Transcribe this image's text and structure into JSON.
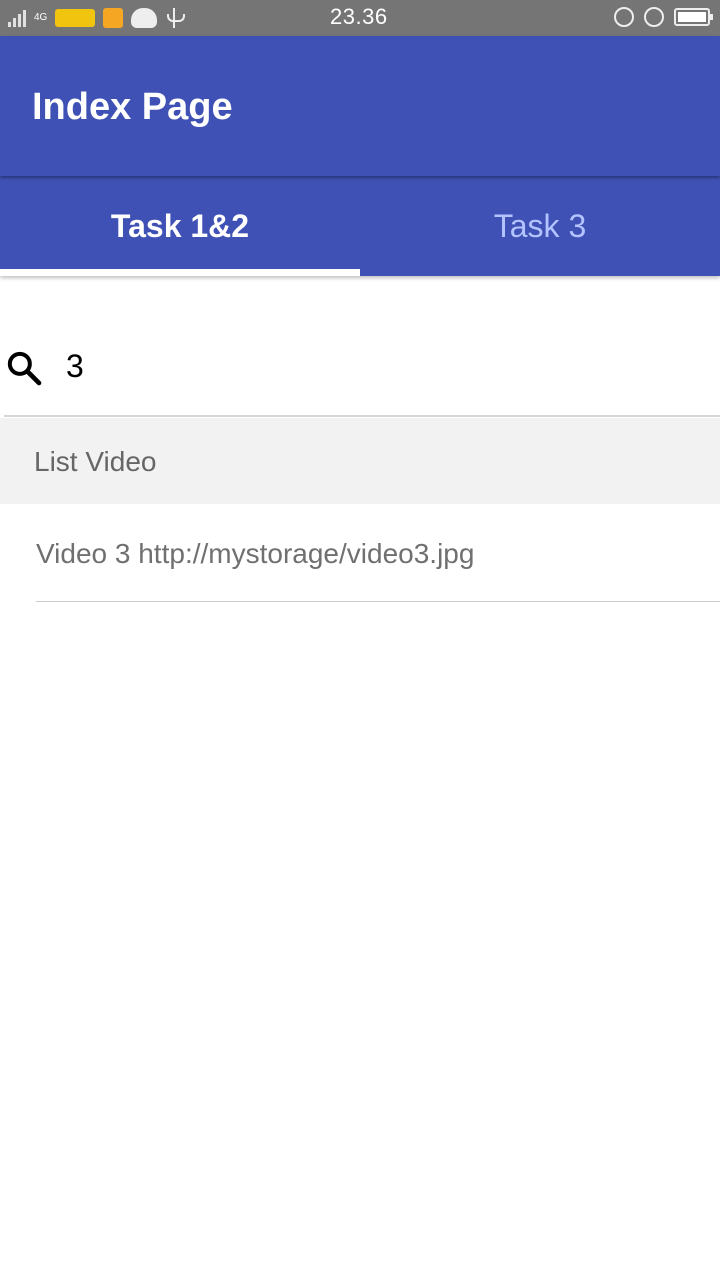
{
  "status_bar": {
    "time": "23.36",
    "network": "4G",
    "icons": [
      "signal-icon",
      "network-4g-icon",
      "indosat-icon",
      "app-badge-icon",
      "android-icon",
      "usb-icon",
      "silent-icon",
      "alarm-icon",
      "battery-icon"
    ]
  },
  "toolbar": {
    "title": "Index Page",
    "color": "#3f51b5"
  },
  "tabs": [
    {
      "label": "Task 1&2",
      "selected": true
    },
    {
      "label": "Task 3",
      "selected": false
    }
  ],
  "search": {
    "value": "3",
    "icon": "search-icon"
  },
  "list": {
    "header": "List Video",
    "items": [
      {
        "text": "Video 3 http://mystorage/video3.jpg"
      }
    ]
  }
}
